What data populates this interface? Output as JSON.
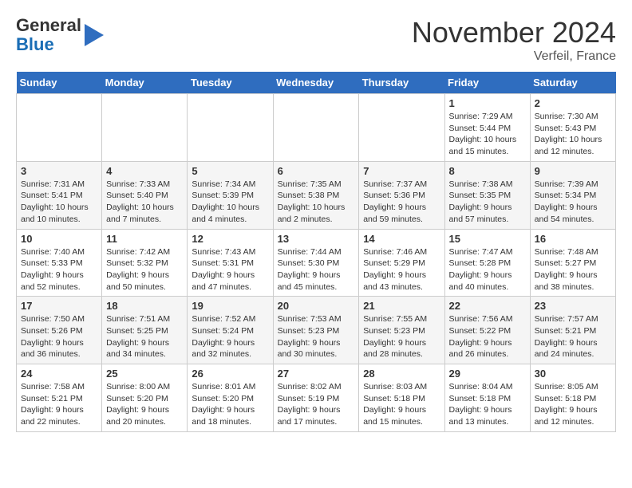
{
  "logo": {
    "general": "General",
    "blue": "Blue"
  },
  "header": {
    "month": "November 2024",
    "location": "Verfeil, France"
  },
  "weekdays": [
    "Sunday",
    "Monday",
    "Tuesday",
    "Wednesday",
    "Thursday",
    "Friday",
    "Saturday"
  ],
  "weeks": [
    [
      {
        "day": "",
        "info": ""
      },
      {
        "day": "",
        "info": ""
      },
      {
        "day": "",
        "info": ""
      },
      {
        "day": "",
        "info": ""
      },
      {
        "day": "",
        "info": ""
      },
      {
        "day": "1",
        "info": "Sunrise: 7:29 AM\nSunset: 5:44 PM\nDaylight: 10 hours and 15 minutes."
      },
      {
        "day": "2",
        "info": "Sunrise: 7:30 AM\nSunset: 5:43 PM\nDaylight: 10 hours and 12 minutes."
      }
    ],
    [
      {
        "day": "3",
        "info": "Sunrise: 7:31 AM\nSunset: 5:41 PM\nDaylight: 10 hours and 10 minutes."
      },
      {
        "day": "4",
        "info": "Sunrise: 7:33 AM\nSunset: 5:40 PM\nDaylight: 10 hours and 7 minutes."
      },
      {
        "day": "5",
        "info": "Sunrise: 7:34 AM\nSunset: 5:39 PM\nDaylight: 10 hours and 4 minutes."
      },
      {
        "day": "6",
        "info": "Sunrise: 7:35 AM\nSunset: 5:38 PM\nDaylight: 10 hours and 2 minutes."
      },
      {
        "day": "7",
        "info": "Sunrise: 7:37 AM\nSunset: 5:36 PM\nDaylight: 9 hours and 59 minutes."
      },
      {
        "day": "8",
        "info": "Sunrise: 7:38 AM\nSunset: 5:35 PM\nDaylight: 9 hours and 57 minutes."
      },
      {
        "day": "9",
        "info": "Sunrise: 7:39 AM\nSunset: 5:34 PM\nDaylight: 9 hours and 54 minutes."
      }
    ],
    [
      {
        "day": "10",
        "info": "Sunrise: 7:40 AM\nSunset: 5:33 PM\nDaylight: 9 hours and 52 minutes."
      },
      {
        "day": "11",
        "info": "Sunrise: 7:42 AM\nSunset: 5:32 PM\nDaylight: 9 hours and 50 minutes."
      },
      {
        "day": "12",
        "info": "Sunrise: 7:43 AM\nSunset: 5:31 PM\nDaylight: 9 hours and 47 minutes."
      },
      {
        "day": "13",
        "info": "Sunrise: 7:44 AM\nSunset: 5:30 PM\nDaylight: 9 hours and 45 minutes."
      },
      {
        "day": "14",
        "info": "Sunrise: 7:46 AM\nSunset: 5:29 PM\nDaylight: 9 hours and 43 minutes."
      },
      {
        "day": "15",
        "info": "Sunrise: 7:47 AM\nSunset: 5:28 PM\nDaylight: 9 hours and 40 minutes."
      },
      {
        "day": "16",
        "info": "Sunrise: 7:48 AM\nSunset: 5:27 PM\nDaylight: 9 hours and 38 minutes."
      }
    ],
    [
      {
        "day": "17",
        "info": "Sunrise: 7:50 AM\nSunset: 5:26 PM\nDaylight: 9 hours and 36 minutes."
      },
      {
        "day": "18",
        "info": "Sunrise: 7:51 AM\nSunset: 5:25 PM\nDaylight: 9 hours and 34 minutes."
      },
      {
        "day": "19",
        "info": "Sunrise: 7:52 AM\nSunset: 5:24 PM\nDaylight: 9 hours and 32 minutes."
      },
      {
        "day": "20",
        "info": "Sunrise: 7:53 AM\nSunset: 5:23 PM\nDaylight: 9 hours and 30 minutes."
      },
      {
        "day": "21",
        "info": "Sunrise: 7:55 AM\nSunset: 5:23 PM\nDaylight: 9 hours and 28 minutes."
      },
      {
        "day": "22",
        "info": "Sunrise: 7:56 AM\nSunset: 5:22 PM\nDaylight: 9 hours and 26 minutes."
      },
      {
        "day": "23",
        "info": "Sunrise: 7:57 AM\nSunset: 5:21 PM\nDaylight: 9 hours and 24 minutes."
      }
    ],
    [
      {
        "day": "24",
        "info": "Sunrise: 7:58 AM\nSunset: 5:21 PM\nDaylight: 9 hours and 22 minutes."
      },
      {
        "day": "25",
        "info": "Sunrise: 8:00 AM\nSunset: 5:20 PM\nDaylight: 9 hours and 20 minutes."
      },
      {
        "day": "26",
        "info": "Sunrise: 8:01 AM\nSunset: 5:20 PM\nDaylight: 9 hours and 18 minutes."
      },
      {
        "day": "27",
        "info": "Sunrise: 8:02 AM\nSunset: 5:19 PM\nDaylight: 9 hours and 17 minutes."
      },
      {
        "day": "28",
        "info": "Sunrise: 8:03 AM\nSunset: 5:18 PM\nDaylight: 9 hours and 15 minutes."
      },
      {
        "day": "29",
        "info": "Sunrise: 8:04 AM\nSunset: 5:18 PM\nDaylight: 9 hours and 13 minutes."
      },
      {
        "day": "30",
        "info": "Sunrise: 8:05 AM\nSunset: 5:18 PM\nDaylight: 9 hours and 12 minutes."
      }
    ]
  ]
}
